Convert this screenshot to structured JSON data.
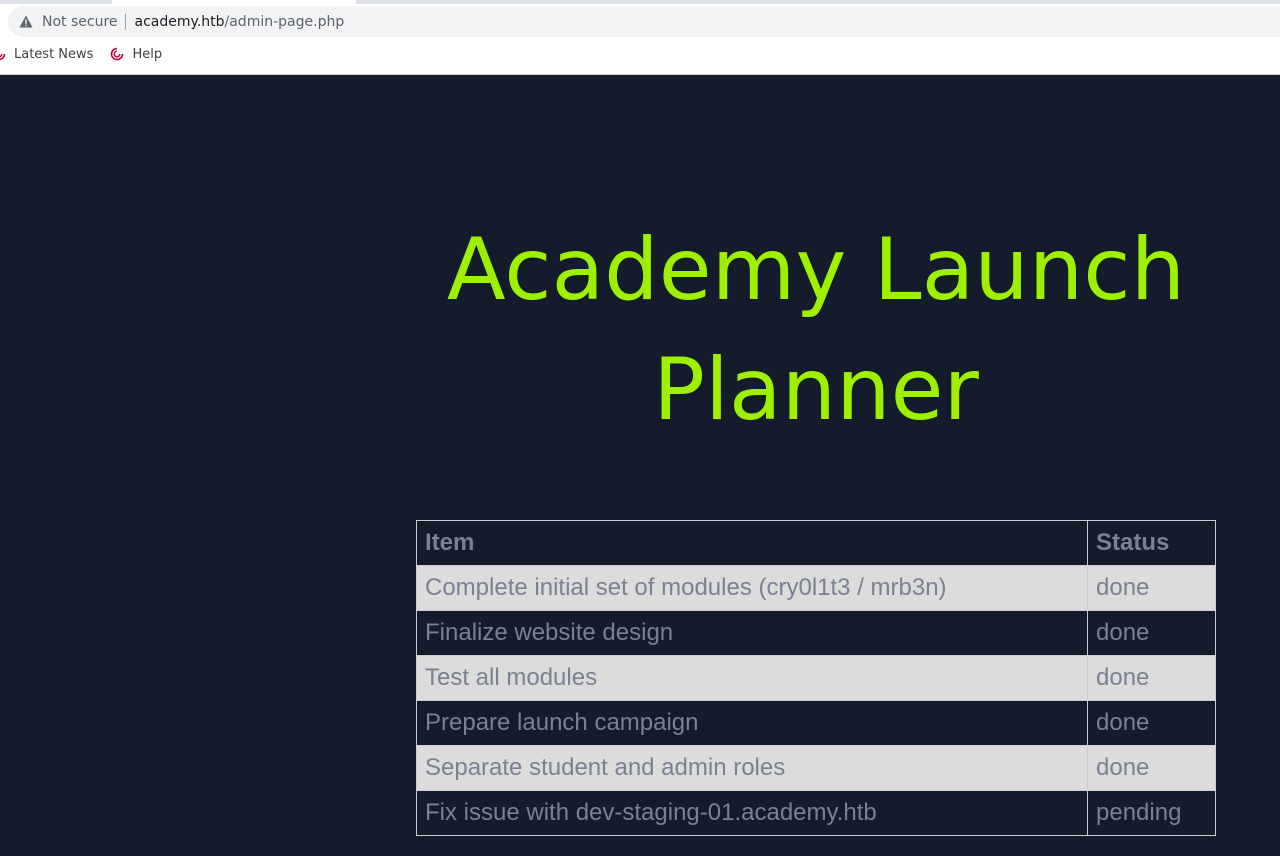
{
  "browser": {
    "security_label": "Not secure",
    "url_host": "academy.htb",
    "url_path": "/admin-page.php",
    "bookmarks": [
      {
        "label": "Latest News"
      },
      {
        "label": "Help"
      }
    ]
  },
  "page": {
    "title": "Academy Launch Planner",
    "table": {
      "headers": [
        "Item",
        "Status"
      ],
      "rows": [
        {
          "item": "Complete initial set of modules (cry0l1t3 / mrb3n)",
          "status": "done"
        },
        {
          "item": "Finalize website design",
          "status": "done"
        },
        {
          "item": "Test all modules",
          "status": "done"
        },
        {
          "item": "Prepare launch campaign",
          "status": "done"
        },
        {
          "item": "Separate student and admin roles",
          "status": "done"
        },
        {
          "item": "Fix issue with dev-staging-01.academy.htb",
          "status": "pending"
        }
      ]
    }
  },
  "colors": {
    "page_background": "#141c2b",
    "title": "#9fef00",
    "table_text": "#7a8191",
    "zebra_row": "#dcdcdc"
  },
  "icons": {
    "security": "warning-icon",
    "bookmark": "debian-swirl-icon"
  }
}
